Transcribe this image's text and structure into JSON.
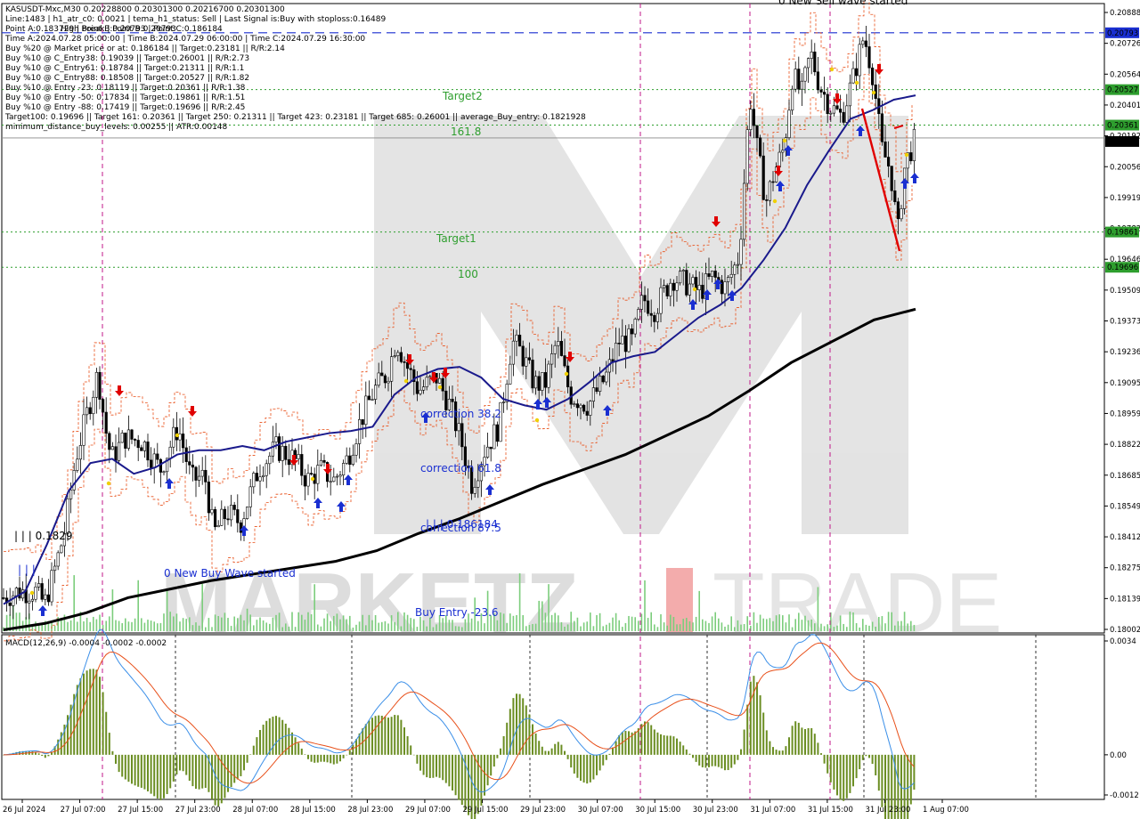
{
  "header": {
    "symbol_line": "KASUSDT-Mxc,M30  0.20228800 0.20301300 0.20216700 0.20301300",
    "info_lines": [
      "Line:1483  |  h1_atr_c0: 0.0021  |  tema_h1_status: Sell  |  Last Signal is:Buy with stoploss:0.16489",
      "Point A:0.183729 | Point B:0.20793 | Point C:0.186184",
      "Time A:2024.07.28 05:00:00  |  Time B:2024.07.29 06:00:00  |  Time C:2024.07.29 16:30:00",
      "Buy %20 @ Market price or at: 0.186184  ||  Target:0.23181  ||  R/R:2.14",
      "Buy %10 @ C_Entry38: 0.19039  ||  Target:0.26001  ||  R/R:2.73",
      "Buy %10 @ C_Entry61: 0.18784  ||  Target:0.21311  ||  R/R:1.1",
      "Buy %10 @ C_Entry88: 0.18508  ||  Target:0.20527  ||  R/R:1.82",
      "Buy %10 @ Entry -23: 0.18119  ||  Target:0.20361  ||  R/R:1.38",
      "Buy %10 @ Entry -50: 0.17834  ||  Target:0.19861  ||  R/R:1.51",
      "Buy %10 @ Entry -88: 0.17419  ||  Target:0.19696  ||  R/R:2.45",
      "Target100: 0.19696  ||  Target 161: 0.20361  ||  Target 250: 0.21311  ||  Target 423: 0.23181  ||  Target 685: 0.26001  ||  average_Buy_entry: 0.1821928",
      "minimum_distance_buy_levels: 0.00255  ||  ATR:0.00148"
    ],
    "overlap_text": "High Break | Point B:0.20793"
  },
  "annotations": {
    "sell_wave": "0 New Sell wave started",
    "buy_wave": "0 New Buy Wave started",
    "target2": "Target2",
    "target1": "Target1",
    "level_100": "100",
    "level_1618": "161.8",
    "correction_382": "correction 38.2",
    "correction_618": "correction 61.8",
    "correction_875": "correction 87.5",
    "point_c": "| | | 0.186184",
    "point_a": "| | | 0.1829",
    "buy_entry": "Buy Entry -23.6",
    "bars_a": "| | |"
  },
  "price_axis": {
    "ticks": [
      "0.20888",
      "0.20726",
      "0.20564",
      "0.20401",
      "0.20192",
      "0.20056",
      "0.19919",
      "0.19782",
      "0.19646",
      "0.19509",
      "0.19373",
      "0.19236",
      "0.19095",
      "0.18959",
      "0.18822",
      "0.18685",
      "0.18549",
      "0.18412",
      "0.18275",
      "0.18139",
      "0.18002"
    ],
    "badges": [
      {
        "text": "0.20793",
        "color": "#1a2fd1",
        "text_color": "#ffffff"
      },
      {
        "text": "0.20527",
        "color": "#2e9e2e",
        "text_color": "#ffffff"
      },
      {
        "text": "0.20361",
        "color": "#2e9e2e",
        "text_color": "#ffffff"
      },
      {
        "text": "0.20301",
        "color": "#000000",
        "text_color": "#ffffff"
      },
      {
        "text": "0.19861",
        "color": "#2e9e2e",
        "text_color": "#ffffff"
      },
      {
        "text": "0.19696",
        "color": "#2e9e2e",
        "text_color": "#ffffff"
      }
    ]
  },
  "macd": {
    "label": "MACD(12,26,9) -0.0004 -0.0002 -0.0002",
    "ticks": [
      "0.0034",
      "0.00",
      "-0.0012"
    ]
  },
  "time_axis": {
    "labels": [
      "26 Jul 2024",
      "27 Jul 07:00",
      "27 Jul 15:00",
      "27 Jul 23:00",
      "28 Jul 07:00",
      "28 Jul 15:00",
      "28 Jul 23:00",
      "29 Jul 07:00",
      "29 Jul 15:00",
      "29 Jul 23:00",
      "30 Jul 07:00",
      "30 Jul 15:00",
      "30 Jul 23:00",
      "31 Jul 07:00",
      "31 Jul 15:00",
      "31 Jul 23:00",
      "1 Aug 07:00"
    ]
  },
  "watermark": {
    "left": "MARKETZ",
    "mid": "I",
    "right": "TRADE"
  },
  "colors": {
    "blue_line": "#1a1a8c",
    "black_line": "#000000",
    "green_dash": "#2e9e2e",
    "blue_dash": "#1a2fd1",
    "buy_arrow": "#1a2fd1",
    "sell_arrow": "#e00000",
    "macd_line": "#3b8fe8",
    "signal_line": "#e8501a",
    "macd_hist": "#6b8e23",
    "volume": "#7ccd7c"
  },
  "chart_data": {
    "type": "candlestick",
    "symbol": "KASUSDT-Mxc",
    "timeframe": "M30",
    "last": {
      "open": 0.202288,
      "high": 0.203013,
      "low": 0.202167,
      "close": 0.203013
    },
    "price_range": [
      0.18002,
      0.20888
    ],
    "levels": [
      {
        "name": "Point B (High Break)",
        "value": 0.20793
      },
      {
        "name": "Target2",
        "value": 0.20527
      },
      {
        "name": "161.8",
        "value": 0.20361
      },
      {
        "name": "Target1",
        "value": 0.19861
      },
      {
        "name": "100",
        "value": 0.19696
      }
    ],
    "ema_fast": [
      0.1812,
      0.1818,
      0.184,
      0.1865,
      0.1878,
      0.188,
      0.1873,
      0.1876,
      0.1882,
      0.1884,
      0.1884,
      0.1886,
      0.1884,
      0.1888,
      0.189,
      0.1892,
      0.1893,
      0.1895,
      0.191,
      0.1918,
      0.1922,
      0.1923,
      0.1918,
      0.1908,
      0.1905,
      0.1903,
      0.1908,
      0.1916,
      0.1925,
      0.1928,
      0.193,
      0.1938,
      0.1946,
      0.1952,
      0.196,
      0.1973,
      0.1988,
      0.2008,
      0.2024,
      0.2039,
      0.2043,
      0.2048,
      0.205
    ],
    "ema_slow": [
      0.18,
      0.1803,
      0.1808,
      0.1815,
      0.1819,
      0.1823,
      0.1826,
      0.1829,
      0.1832,
      0.1837,
      0.1845,
      0.1852,
      0.186,
      0.1868,
      0.1875,
      0.1882,
      0.1891,
      0.19,
      0.1912,
      0.1925,
      0.1935,
      0.1945,
      0.195
    ],
    "macd_range": [
      -0.0012,
      0.0034
    ]
  }
}
